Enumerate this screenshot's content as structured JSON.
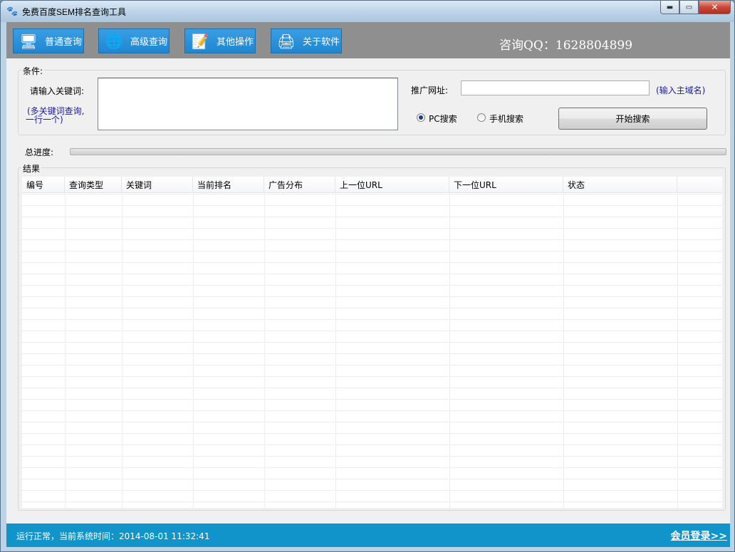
{
  "window": {
    "title": "免费百度SEM排名查询工具",
    "minimize_glyph": "▬",
    "maximize_glyph": "▭",
    "close_glyph": "✕"
  },
  "toolbar": {
    "buttons": [
      {
        "label": "普通查询",
        "icon": "computer-icon"
      },
      {
        "label": "高级查询",
        "icon": "network-icon"
      },
      {
        "label": "其他操作",
        "icon": "notepad-icon"
      },
      {
        "label": "关于软件",
        "icon": "printer-icon"
      }
    ],
    "qq": "咨询QQ：1628804899"
  },
  "conditions": {
    "legend": "条件:",
    "keyword_label": "请输入关键词:",
    "keyword_hint_line1": "(多关键词查询,",
    "keyword_hint_line2": "一行一个)",
    "keyword_value": "",
    "url_label": "推广网址:",
    "url_value": "",
    "url_hint": "(输入主域名)",
    "radio_pc": "PC搜索",
    "radio_mobile": "手机搜索",
    "selected_mode": "pc",
    "search_button": "开始搜索"
  },
  "progress": {
    "label": "总进度:",
    "value": 0
  },
  "results": {
    "legend": "结果",
    "columns": [
      "编号",
      "查询类型",
      "关键词",
      "当前排名",
      "广告分布",
      "上一位URL",
      "下一位URL",
      "状态"
    ],
    "rows": []
  },
  "status": {
    "text": "运行正常，当前系统时间：2014-08-01 11:32:41",
    "login_link": "会员登录>>"
  },
  "colors": {
    "toolbar_button": "#2b93dc",
    "status_bar": "#1094c9",
    "hint_text": "#1b1b9c"
  }
}
